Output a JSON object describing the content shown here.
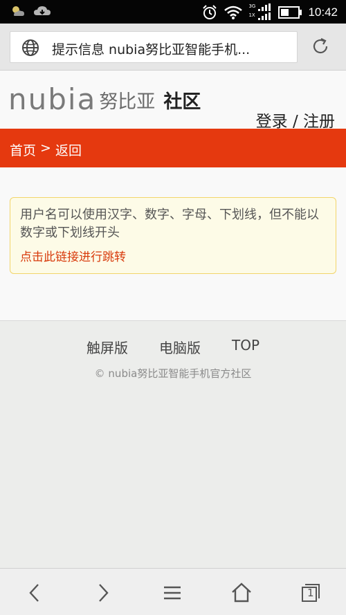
{
  "status_bar": {
    "time": "10:42",
    "network_label_top": "3G",
    "network_label_bottom": "1X",
    "icons": [
      "weather-icon",
      "cloud-icon",
      "alarm-icon",
      "wifi-icon",
      "signal-icon",
      "battery-icon"
    ]
  },
  "browser": {
    "url_text": "提示信息 nubia努比亚智能手机...",
    "icons": {
      "left": "globe-icon",
      "right": "refresh-icon"
    }
  },
  "header": {
    "logo_wordmark": "nubia",
    "logo_cn": "努比亚",
    "logo_community": "社区",
    "login": "登录",
    "separator": "/",
    "register": "注册"
  },
  "nav": {
    "home": "首页",
    "arrow": ">",
    "back": "返回"
  },
  "notice": {
    "message": "用户名可以使用汉字、数字、字母、下划线，但不能以数字或下划线开头",
    "link": "点击此链接进行跳转"
  },
  "footer": {
    "links": [
      "触屏版",
      "电脑版",
      "TOP"
    ],
    "copyright": "© nubia努比亚智能手机官方社区"
  },
  "bottom_bar": {
    "tab_count": "1",
    "icons": [
      "back-arrow-icon",
      "forward-arrow-icon",
      "menu-icon",
      "home-icon",
      "tabs-icon"
    ]
  },
  "colors": {
    "accent": "#e5390f",
    "notice_bg": "#fdfbe7",
    "notice_border": "#f2d56a",
    "link": "#d83a0b"
  }
}
